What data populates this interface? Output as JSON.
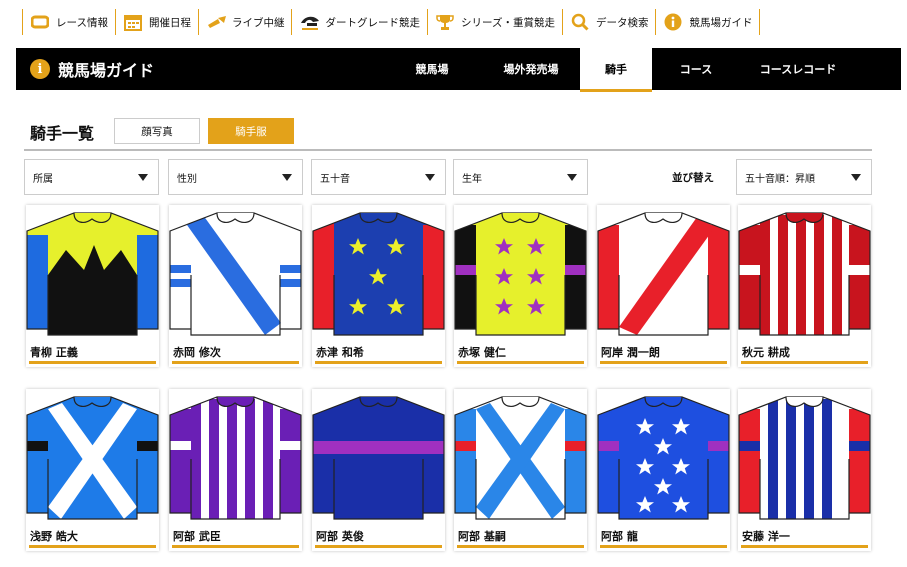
{
  "topnav": [
    {
      "label": "レース情報",
      "icon": "race-info-icon"
    },
    {
      "label": "開催日程",
      "icon": "calendar-icon"
    },
    {
      "label": "ライブ中継",
      "icon": "live-icon"
    },
    {
      "label": "ダートグレード競走",
      "icon": "dirt-grade-logo-icon"
    },
    {
      "label": "シリーズ・重賞競走",
      "icon": "trophy-icon"
    },
    {
      "label": "データ検索",
      "icon": "search-icon"
    },
    {
      "label": "競馬場ガイド",
      "icon": "info-icon"
    }
  ],
  "bar": {
    "title": "競馬場ガイド",
    "tabs": [
      "競馬場",
      "場外発売場",
      "騎手",
      "コース",
      "コースレコード"
    ],
    "active_tab": "騎手"
  },
  "heading": "騎手一覧",
  "view_toggle": {
    "photo": "顔写真",
    "silks": "騎手服",
    "active": "騎手服"
  },
  "filters": {
    "affiliation": "所属",
    "gender": "性別",
    "kana": "五十音",
    "birth_year": "生年"
  },
  "sort": {
    "label": "並び替え",
    "value": "五十音順：昇順"
  },
  "colors": {
    "accent": "#e3a21a",
    "bar": "#000000"
  },
  "jockeys": [
    {
      "name": "青柳 正義",
      "silk": "yellow-black-sawtooth-blue-sleeves"
    },
    {
      "name": "赤岡 修次",
      "silk": "white-blue-sash"
    },
    {
      "name": "赤津 和希",
      "silk": "blue-yellow-stars-red-sleeves"
    },
    {
      "name": "赤塚 健仁",
      "silk": "yellow-purple-stars-black-sleeves"
    },
    {
      "name": "阿岸 潤一朗",
      "silk": "white-red-sash-red-sleeves"
    },
    {
      "name": "秋元 耕成",
      "silk": "red-white-stripes"
    },
    {
      "name": "浅野 皓大",
      "silk": "blue-white-cross"
    },
    {
      "name": "阿部 武臣",
      "silk": "purple-white-stripes"
    },
    {
      "name": "阿部 英俊",
      "silk": "navy-purple-hoop"
    },
    {
      "name": "阿部 基嗣",
      "silk": "white-blue-cross"
    },
    {
      "name": "阿部 龍",
      "silk": "blue-white-stars"
    },
    {
      "name": "安藤 洋一",
      "silk": "white-blue-stripes-red-sleeves"
    }
  ]
}
